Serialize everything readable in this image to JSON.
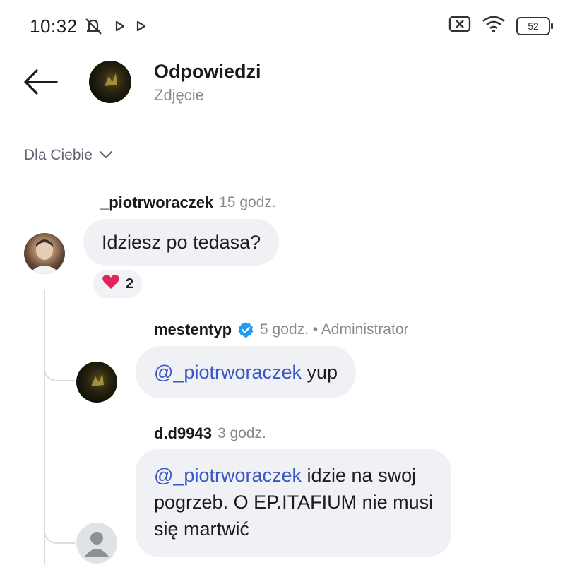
{
  "status_bar": {
    "time": "10:32",
    "battery": "52"
  },
  "header": {
    "title": "Odpowiedzi",
    "subtitle": "Zdjęcie"
  },
  "filter": {
    "label": "Dla Ciebie"
  },
  "comments": [
    {
      "username": "_piotrworaczek",
      "time": "15 godz.",
      "text": "Idziesz po tedasa?",
      "reaction_count": "2"
    },
    {
      "username": "mestentyp",
      "time": "5 godz. • Administrator",
      "mention": "@_piotrworaczek",
      "text": " yup"
    },
    {
      "username": "d.d9943",
      "time": "3 godz.",
      "mention": "@_piotrworaczek",
      "text_line1": " idzie na swoj",
      "text_line2": "pogrzeb. O EP.ITAFIUM nie musi",
      "text_line3": "się martwić"
    }
  ],
  "icons": {
    "status_left": [
      "mute-icon",
      "play-icon",
      "play-icon"
    ],
    "status_right": [
      "sim-off-icon",
      "wifi-icon",
      "battery-icon"
    ],
    "back": "back-arrow-icon",
    "filter": "chevron-down-icon",
    "reaction": "heart-icon",
    "verified": "verified-badge-icon"
  },
  "colors": {
    "mention": "#3b57c4",
    "bubble": "#eff1f4",
    "verified": "#1d9bf0",
    "heart": "#e0245e"
  }
}
